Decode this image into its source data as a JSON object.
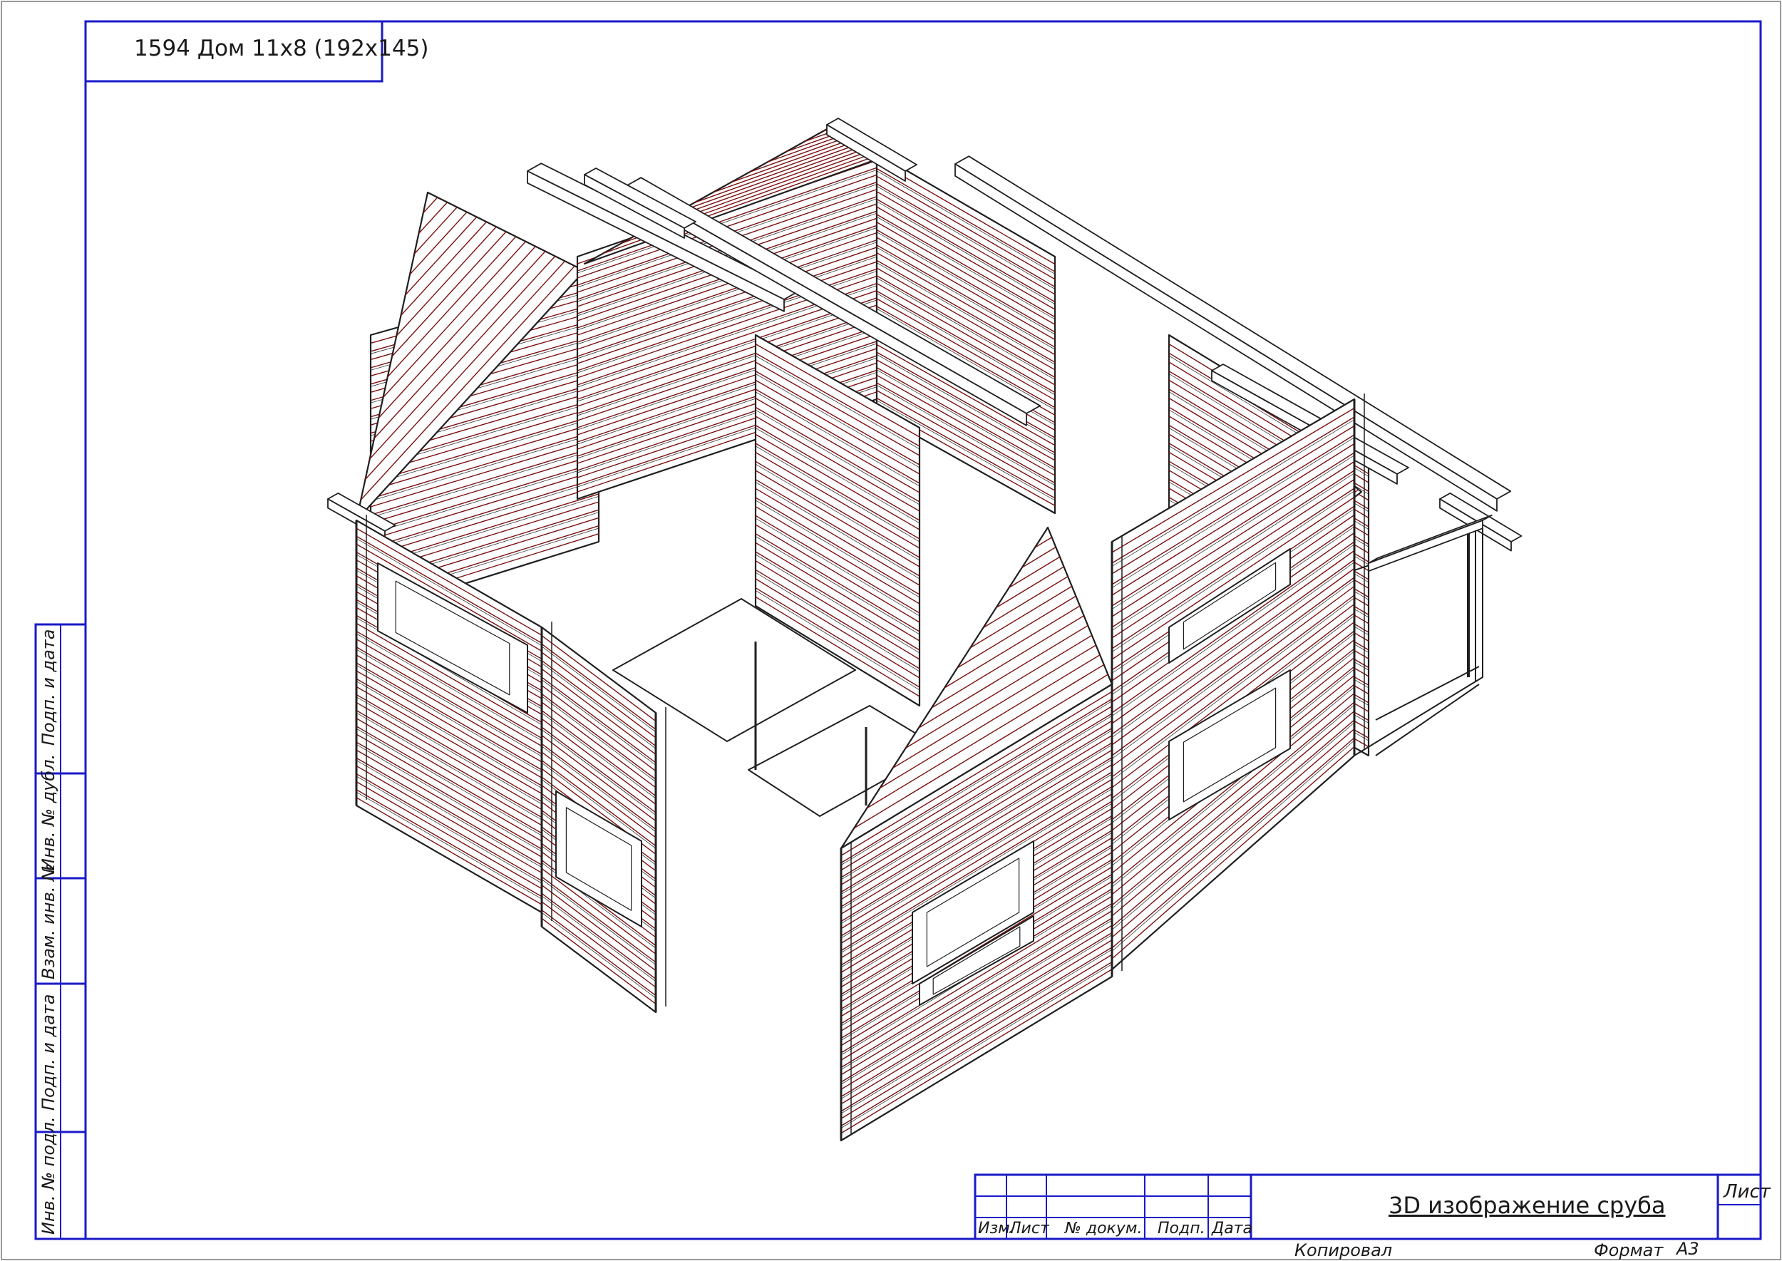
{
  "drawing": {
    "title": "1594 Дом 11x8 (192x145)",
    "main_caption": "3D изображение сруба",
    "sheet_label": "Лист",
    "copied_label": "Копировал",
    "format_label": "Формат",
    "format_value": "А3"
  },
  "title_block": {
    "headers": [
      "Изм.",
      "Лист",
      "№ докум.",
      "Подп.",
      "Дата"
    ]
  },
  "side_stamp": {
    "labels": [
      "Подп. и дата",
      "Инв. № дубл.",
      "Взам. инв. №",
      "Подп. и дата",
      "Инв. № подл."
    ]
  },
  "colors": {
    "frame": "#1a1ac8",
    "log_lines": "#7a1010",
    "edges": "#1f1f1f"
  }
}
